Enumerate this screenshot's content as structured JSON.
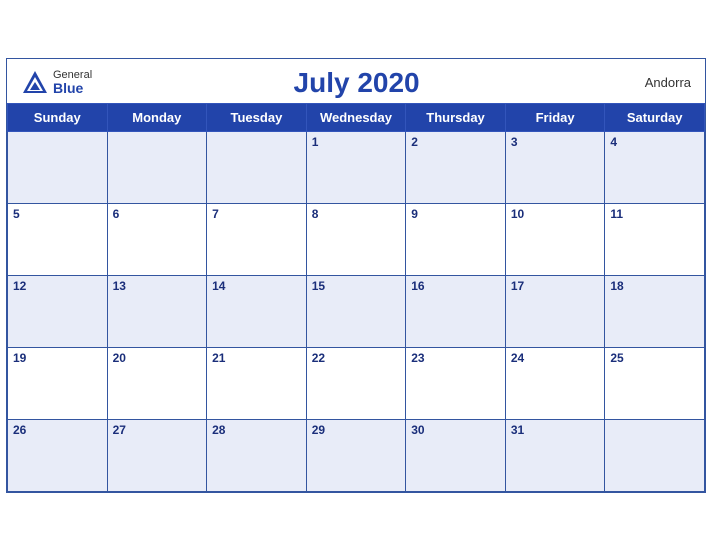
{
  "header": {
    "logo_general": "General",
    "logo_blue": "Blue",
    "month_title": "July 2020",
    "country": "Andorra"
  },
  "days_of_week": [
    "Sunday",
    "Monday",
    "Tuesday",
    "Wednesday",
    "Thursday",
    "Friday",
    "Saturday"
  ],
  "weeks": [
    [
      null,
      null,
      null,
      1,
      2,
      3,
      4
    ],
    [
      5,
      6,
      7,
      8,
      9,
      10,
      11
    ],
    [
      12,
      13,
      14,
      15,
      16,
      17,
      18
    ],
    [
      19,
      20,
      21,
      22,
      23,
      24,
      25
    ],
    [
      26,
      27,
      28,
      29,
      30,
      31,
      null
    ]
  ]
}
